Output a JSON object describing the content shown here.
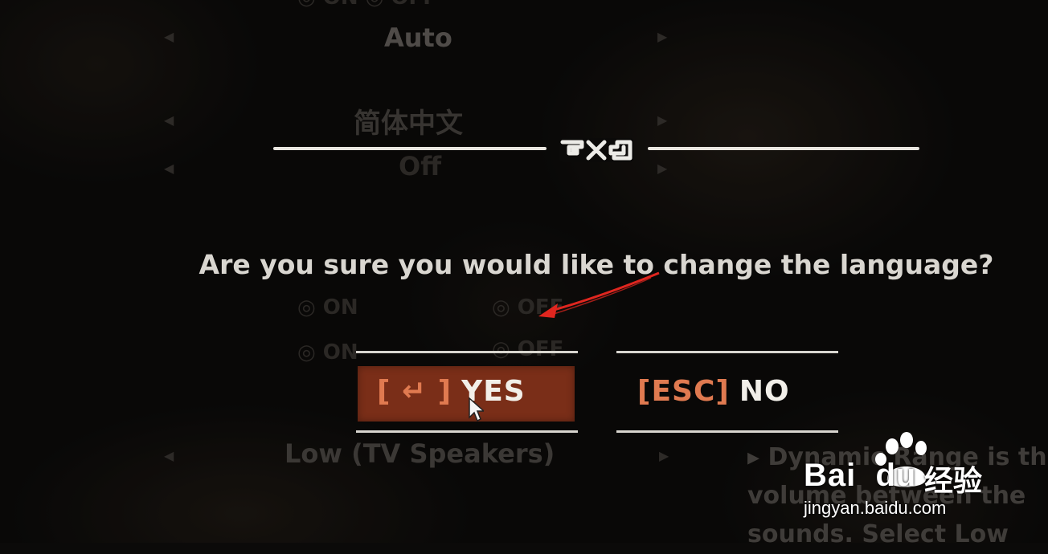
{
  "background_menu": {
    "top_partial": "◎ ON          ◎ OFF",
    "auto": "Auto",
    "language": "简体中文",
    "off": "Off",
    "on_row": "◎ ON",
    "off_row": "◎ OFF",
    "speakers": "Low (TV Speakers)",
    "description": "▸ Dynamic Range is th\nvolume between the\nsounds. Select Low"
  },
  "dialog": {
    "question": "Are you sure you would like to change the language?",
    "yes_key": "[ ↵ ]",
    "yes_label": "YES",
    "no_key": "[ESC]",
    "no_label": "NO"
  },
  "watermark": {
    "brand": "Bai  du",
    "service": "经验",
    "url": "jingyan.baidu.com"
  },
  "colors": {
    "accent": "#e07a50",
    "yes_fill": "#7a2e18",
    "text": "#d9d6d0",
    "annotation_arrow": "#e0261f"
  }
}
